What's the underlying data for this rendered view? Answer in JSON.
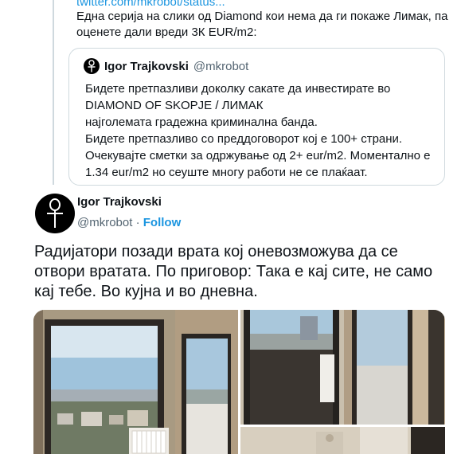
{
  "previous_tweet": {
    "link": "twitter.com/mkrobot/status...",
    "text": "Една серија на слики од Diamond кои нема да ги покаже Лимак, па оценете дали вреди 3К EUR/m2:"
  },
  "quoted_tweet": {
    "name": "Igor Trajkovski",
    "handle": "@mkrobot",
    "lines": [
      "Бидете претпазливи доколку сакате да инвестирате во",
      "DIAMOND OF SKOPJE / ЛИМАК",
      "најголемата градежна криминална банда.",
      "Бидете претпазливо со преддоговорот кој е 100+ страни.",
      "Очекувајте сметки за одржување од 2+ eur/m2. Моментално е",
      "1.34 eur/m2 но сеуште многу работи не се плаќаат."
    ]
  },
  "tweet": {
    "author_name": "Igor Trajkovski",
    "handle": "@mkrobot",
    "separator": "·",
    "follow_label": "Follow",
    "text_lines": [
      "Радијатори позади врата кој оневозможува да се",
      "отвори вратата. По пригoвор: Така е кај сите, не само",
      "кај тебе. Во кујна и во дневна."
    ],
    "photos": [
      {
        "alt": "Window view with radiator behind door"
      },
      {
        "alt": "Balcony door view"
      },
      {
        "alt": "Interior wall"
      }
    ]
  },
  "colors": {
    "link": "#1b95e0",
    "text": "#0f1419",
    "secondary": "#536471",
    "border": "#cfd9de"
  },
  "icons": {
    "avatar": "ankh-icon"
  }
}
